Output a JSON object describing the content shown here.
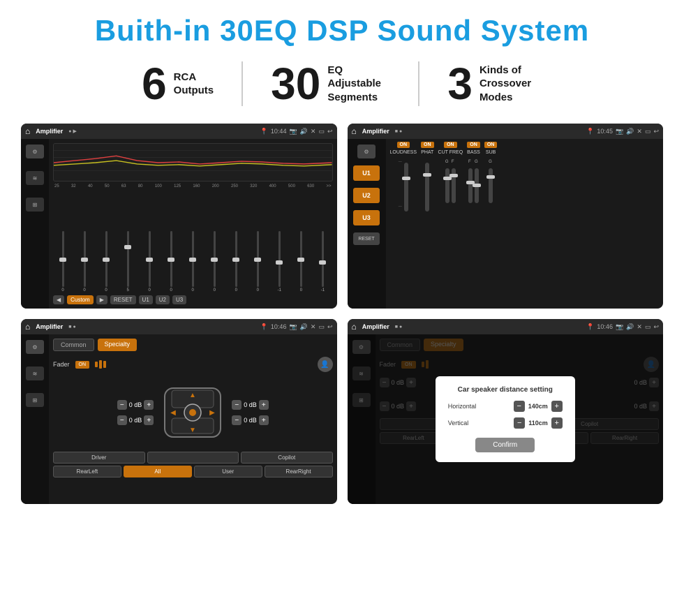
{
  "page": {
    "title": "Buith-in 30EQ DSP Sound System",
    "stats": [
      {
        "number": "6",
        "text": "RCA\nOutputs"
      },
      {
        "number": "30",
        "text": "EQ Adjustable\nSegments"
      },
      {
        "number": "3",
        "text": "Kinds of\nCrossover Modes"
      }
    ],
    "screens": [
      {
        "id": "screen1",
        "topbar_title": "Amplifier",
        "time": "10:44",
        "type": "eq"
      },
      {
        "id": "screen2",
        "topbar_title": "Amplifier",
        "time": "10:45",
        "type": "amp"
      },
      {
        "id": "screen3",
        "topbar_title": "Amplifier",
        "time": "10:46",
        "type": "speaker"
      },
      {
        "id": "screen4",
        "topbar_title": "Amplifier",
        "time": "10:46",
        "type": "dialog"
      }
    ],
    "eq": {
      "freqs": [
        "25",
        "32",
        "40",
        "50",
        "63",
        "80",
        "100",
        "125",
        "160",
        "200",
        "250",
        "320",
        "400",
        "500",
        "630"
      ],
      "values": [
        "0",
        "0",
        "0",
        "5",
        "0",
        "0",
        "0",
        "0",
        "0",
        "0",
        "-1",
        "0",
        "-1",
        "",
        ""
      ],
      "modes": [
        "Custom",
        "RESET",
        "U1",
        "U2",
        "U3"
      ]
    },
    "amp": {
      "units": [
        "U1",
        "U2",
        "U3"
      ],
      "controls": [
        "LOUDNESS",
        "PHAT",
        "CUT FREQ",
        "BASS",
        "SUB"
      ],
      "reset": "RESET"
    },
    "speaker": {
      "tabs": [
        "Common",
        "Specialty"
      ],
      "active_tab": "Specialty",
      "fader_label": "Fader",
      "fader_on": "ON",
      "top_left_db": "0 dB",
      "top_right_db": "0 dB",
      "bot_left_db": "0 dB",
      "bot_right_db": "0 dB",
      "buttons": [
        "Driver",
        "",
        "Copilot",
        "RearLeft",
        "All",
        "User",
        "RearRight"
      ]
    },
    "dialog": {
      "title": "Car speaker distance setting",
      "horizontal_label": "Horizontal",
      "horizontal_value": "140cm",
      "vertical_label": "Vertical",
      "vertical_value": "110cm",
      "confirm_label": "Confirm"
    }
  }
}
